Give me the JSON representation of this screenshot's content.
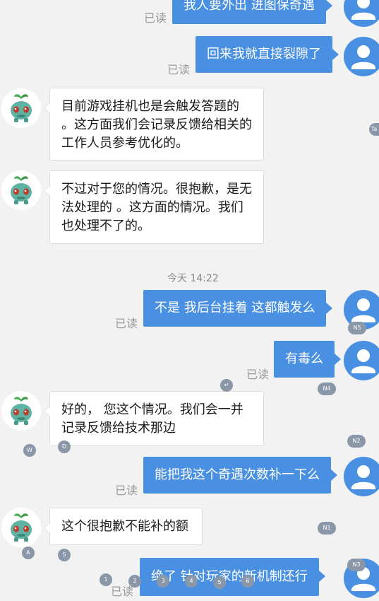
{
  "chat": {
    "read_label": "已读",
    "time_divider": "今天 14:22",
    "messages": [
      {
        "text": "我人要外出  进图保奇遇"
      },
      {
        "text": "回来我就直接裂隙了"
      },
      {
        "text": "目前游戏挂机也是会触发答题的 。这方面我们会记录反馈给相关的工作人员参考优化的。"
      },
      {
        "text": "不过对于您的情况。很抱歉，是无法处理的 。这方面的情况。我们也处理不了的。"
      },
      {
        "text": "不是  我后台挂着  这都触发么"
      },
      {
        "text": "有毒么"
      },
      {
        "text": "好的， 您这个情况。我们会一并记录反馈给技术那边"
      },
      {
        "text": "能把我这个奇遇次数补一下么"
      },
      {
        "text": "这个很抱歉不能补的额"
      },
      {
        "text": "绝了    针对玩家的新机制还行"
      }
    ]
  },
  "overlay": {
    "chips": [
      "Ta",
      "N5",
      "N4",
      "N2",
      "N1",
      "N3",
      "W",
      "D",
      "A",
      "S",
      "1",
      "2",
      "3",
      "4",
      "5",
      "6",
      "↵"
    ]
  },
  "colors": {
    "bubble_out": "#4a90e2",
    "avatar_user": "#4a90e2",
    "background": "#f2f2f2"
  }
}
